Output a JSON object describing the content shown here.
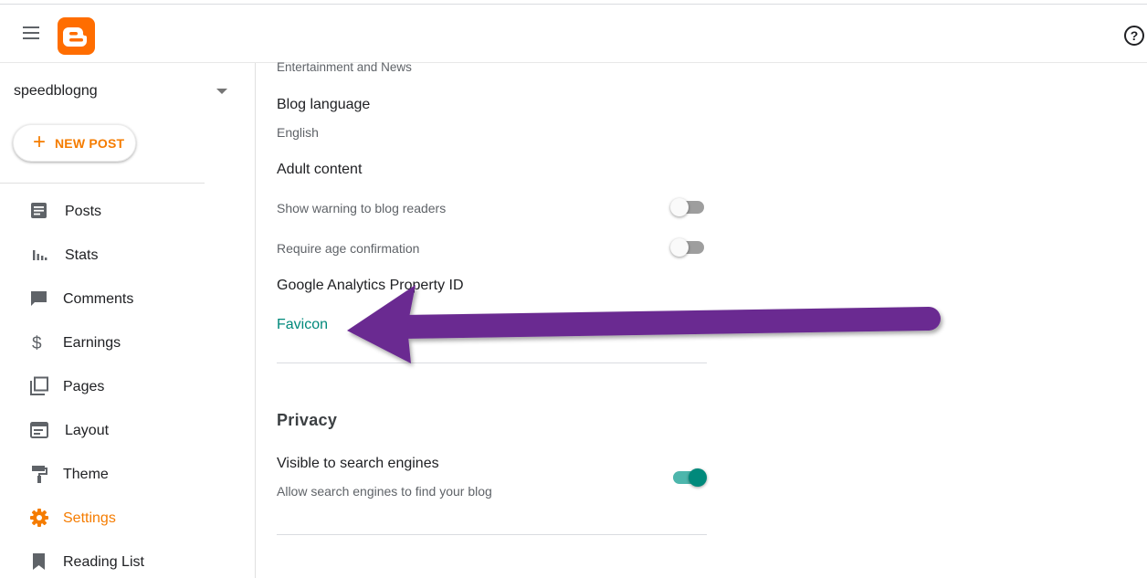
{
  "header": {
    "menu_icon": "hamburger-menu-icon",
    "logo": "blogger-logo",
    "help_icon": "help-circle-icon",
    "help_glyph": "?"
  },
  "sidebar": {
    "blog_name": "speedblogng",
    "new_post_plus": "+",
    "new_post_label": "NEW POST",
    "items": [
      {
        "label": "Posts",
        "icon": "posts-icon",
        "active": false
      },
      {
        "label": "Stats",
        "icon": "stats-icon",
        "active": false
      },
      {
        "label": "Comments",
        "icon": "comments-icon",
        "active": false
      },
      {
        "label": "Earnings",
        "icon": "dollar-icon",
        "active": false
      },
      {
        "label": "Pages",
        "icon": "pages-icon",
        "active": false
      },
      {
        "label": "Layout",
        "icon": "layout-icon",
        "active": false
      },
      {
        "label": "Theme",
        "icon": "paint-roller-icon",
        "active": false
      },
      {
        "label": "Settings",
        "icon": "gear-icon",
        "active": true
      },
      {
        "label": "Reading List",
        "icon": "bookmark-icon",
        "active": false
      }
    ]
  },
  "main": {
    "category_value": "Entertainment and News",
    "blog_language_heading": "Blog language",
    "blog_language_value": "English",
    "adult_content_heading": "Adult content",
    "show_warning_label": "Show warning to blog readers",
    "show_warning_on": false,
    "age_confirmation_label": "Require age confirmation",
    "age_confirmation_on": false,
    "analytics_heading": "Google Analytics Property ID",
    "favicon_link": "Favicon",
    "privacy_section": "Privacy",
    "visible_heading": "Visible to search engines",
    "visible_desc": "Allow search engines to find your blog",
    "visible_on": true
  },
  "colors": {
    "accent_orange": "#f57c00",
    "teal": "#00897b",
    "annotation_arrow": "#6a2c91"
  }
}
